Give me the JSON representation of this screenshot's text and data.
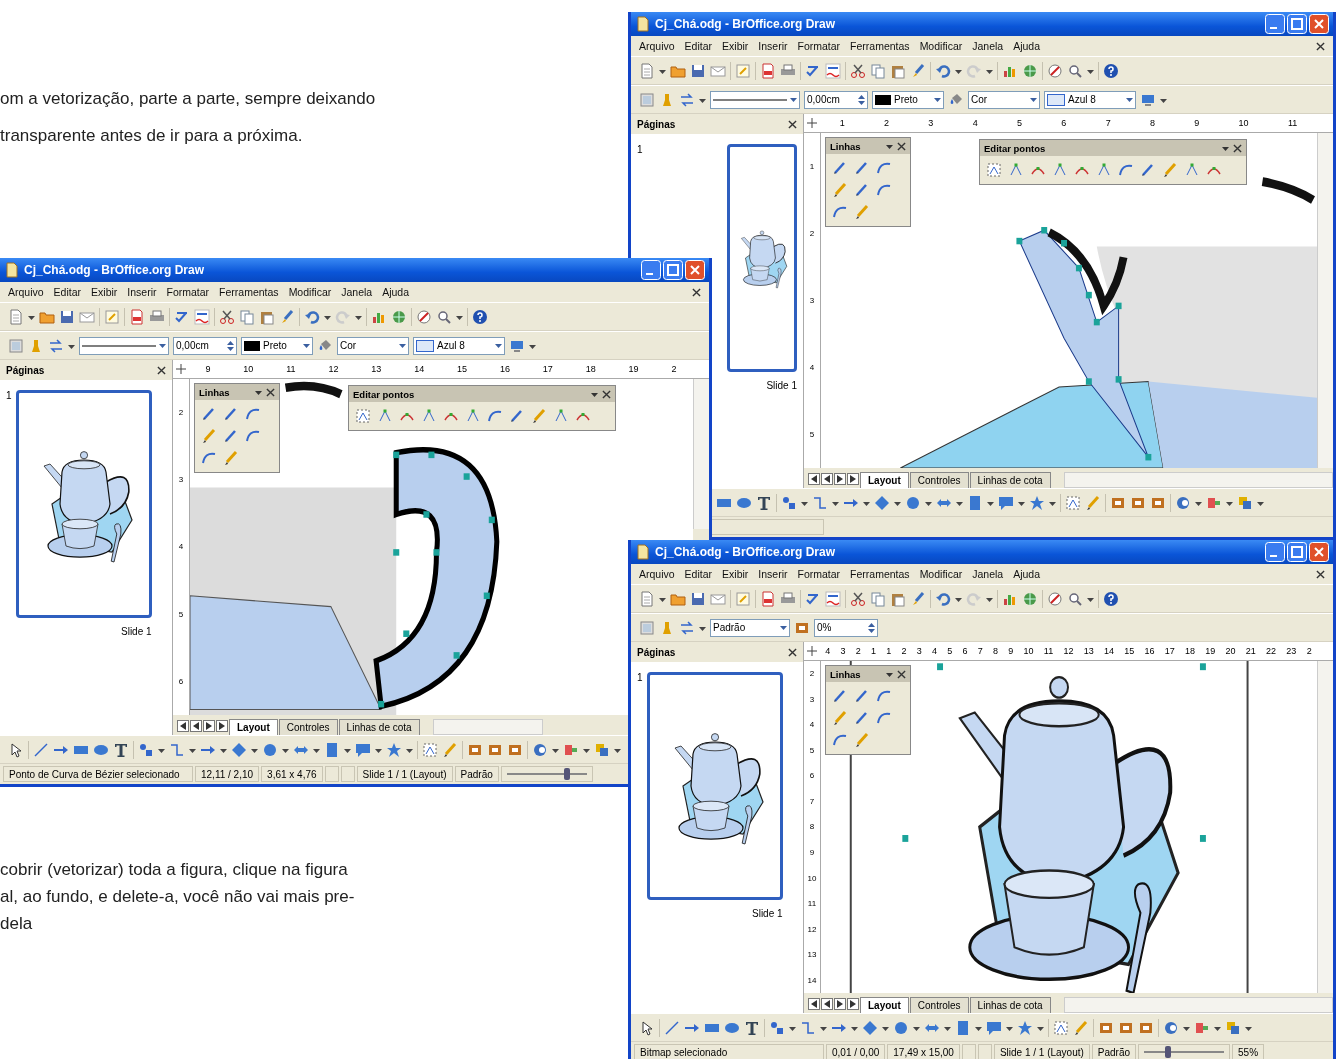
{
  "document": {
    "paragraphs": [
      {
        "lines": [
          "om a vetorização, parte a parte, sempre deixando",
          "transparente antes de ir para a próxima."
        ]
      },
      {
        "lines": [
          "cobrir (vetorizar) toda a figura, clique na figura",
          "al, ao fundo, e delete-a, você não vai mais pre-",
          "dela"
        ]
      }
    ]
  },
  "windows": [
    {
      "title": "Cj_Chá.odg - BrOffice.org Draw",
      "menu": [
        "Arquivo",
        "Editar",
        "Exibir",
        "Inserir",
        "Formatar",
        "Ferramentas",
        "Modificar",
        "Janela",
        "Ajuda"
      ],
      "toolbar_fields": [
        {
          "kind": "line-style"
        },
        {
          "kind": "spin",
          "value": "0,00cm"
        },
        {
          "kind": "line-color",
          "value": "Preto"
        },
        {
          "kind": "area-style",
          "value": "Cor"
        },
        {
          "kind": "area-fill",
          "value": "Azul 8"
        }
      ],
      "pages_panel": {
        "title": "Páginas",
        "slide_number": "1",
        "slide_label": "Slide 1"
      },
      "ruler": [
        "1",
        "2",
        "3",
        "4",
        "5",
        "6",
        "7",
        "8",
        "9",
        "10",
        "11"
      ],
      "vertical_ruler": [
        "1",
        "2",
        "3",
        "4",
        "5"
      ],
      "floating_toolbars": [
        {
          "kind": "lines",
          "title": "Linhas"
        },
        {
          "kind": "points",
          "title": "Editar pontos"
        }
      ],
      "canvas": {
        "kind": "spout"
      },
      "tabs": [
        {
          "label": "Layout",
          "selected": true
        },
        {
          "label": "Controles",
          "selected": false
        },
        {
          "label": "Linhas de cota",
          "selected": false
        }
      ]
    },
    {
      "title": "Cj_Chá.odg - BrOffice.org Draw",
      "menu": [
        "Arquivo",
        "Editar",
        "Exibir",
        "Inserir",
        "Formatar",
        "Ferramentas",
        "Modificar",
        "Janela",
        "Ajuda"
      ],
      "toolbar_fields": [
        {
          "kind": "line-style"
        },
        {
          "kind": "spin",
          "value": "0,00cm"
        },
        {
          "kind": "line-color",
          "value": "Preto"
        },
        {
          "kind": "area-style",
          "value": "Cor"
        },
        {
          "kind": "area-fill",
          "value": "Azul 8"
        }
      ],
      "pages_panel": {
        "title": "Páginas",
        "slide_number": "1",
        "slide_label": "Slide 1"
      },
      "ruler": [
        "9",
        "10",
        "11",
        "12",
        "13",
        "14",
        "15",
        "16",
        "17",
        "18",
        "19",
        "2"
      ],
      "vertical_ruler": [
        "2",
        "3",
        "4",
        "5",
        "6"
      ],
      "floating_toolbars": [
        {
          "kind": "lines",
          "title": "Linhas"
        },
        {
          "kind": "points",
          "title": "Editar pontos"
        }
      ],
      "canvas": {
        "kind": "handle"
      },
      "tabs": [
        {
          "label": "Layout",
          "selected": true
        },
        {
          "label": "Controles",
          "selected": false
        },
        {
          "label": "Linhas de cota",
          "selected": false
        }
      ],
      "status_bar": {
        "message": "Ponto de Curva de Bézier selecionado",
        "position": "12,11 / 2,10",
        "size": "3,61 x 4,76",
        "slide": "Slide 1 / 1 (Layout)",
        "style": "Padrão",
        "zoom_slider": {
          "level": 0.75
        }
      }
    },
    {
      "title": "Cj_Chá.odg - BrOffice.org Draw",
      "menu": [
        "Arquivo",
        "Editar",
        "Exibir",
        "Inserir",
        "Formatar",
        "Ferramentas",
        "Modificar",
        "Janela",
        "Ajuda"
      ],
      "toolbar_fields": [
        {
          "kind": "combo",
          "value": "Padrão"
        },
        {
          "kind": "spin",
          "value": "0%"
        }
      ],
      "pages_panel": {
        "title": "Páginas",
        "slide_number": "1",
        "slide_label": "Slide 1"
      },
      "ruler": [
        "4",
        "3",
        "2",
        "1",
        "1",
        "2",
        "3",
        "4",
        "5",
        "6",
        "7",
        "8",
        "9",
        "10",
        "11",
        "12",
        "13",
        "14",
        "15",
        "16",
        "17",
        "18",
        "19",
        "20",
        "21",
        "22",
        "23",
        "2"
      ],
      "vertical_ruler": [
        "2",
        "3",
        "4",
        "5",
        "6",
        "7",
        "8",
        "9",
        "10",
        "11",
        "12",
        "13",
        "14"
      ],
      "floating_toolbars": [
        {
          "kind": "lines",
          "title": "Linhas"
        }
      ],
      "canvas": {
        "kind": "full"
      },
      "tabs": [
        {
          "label": "Layout",
          "selected": true
        },
        {
          "label": "Controles",
          "selected": false
        },
        {
          "label": "Linhas de cota",
          "selected": false
        }
      ],
      "status_bar": {
        "message": "Bitmap selecionado",
        "position": "0,01 / 0,00",
        "size": "17,49 x 15,00",
        "slide": "Slide 1 / 1 (Layout)",
        "style": "Padrão",
        "zoom_slider": {
          "level": 0.3
        },
        "zoom": "55%"
      }
    }
  ]
}
